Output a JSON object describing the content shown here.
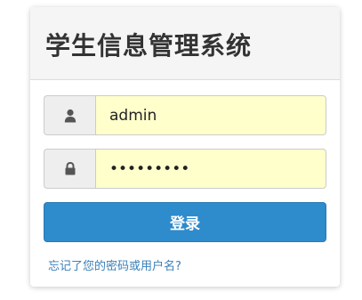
{
  "header": {
    "title": "学生信息管理系统"
  },
  "form": {
    "username": {
      "icon": "user-icon",
      "value": "admin"
    },
    "password": {
      "icon": "lock-icon",
      "value": "•••••••••"
    },
    "login_button_label": "登录",
    "forgot_link_text": "忘记了您的密码或用户名?"
  },
  "colors": {
    "input_background": "#ffffcc",
    "button": "#2e8bcc",
    "link": "#3a7fb8",
    "heading_background": "#f5f5f5"
  }
}
